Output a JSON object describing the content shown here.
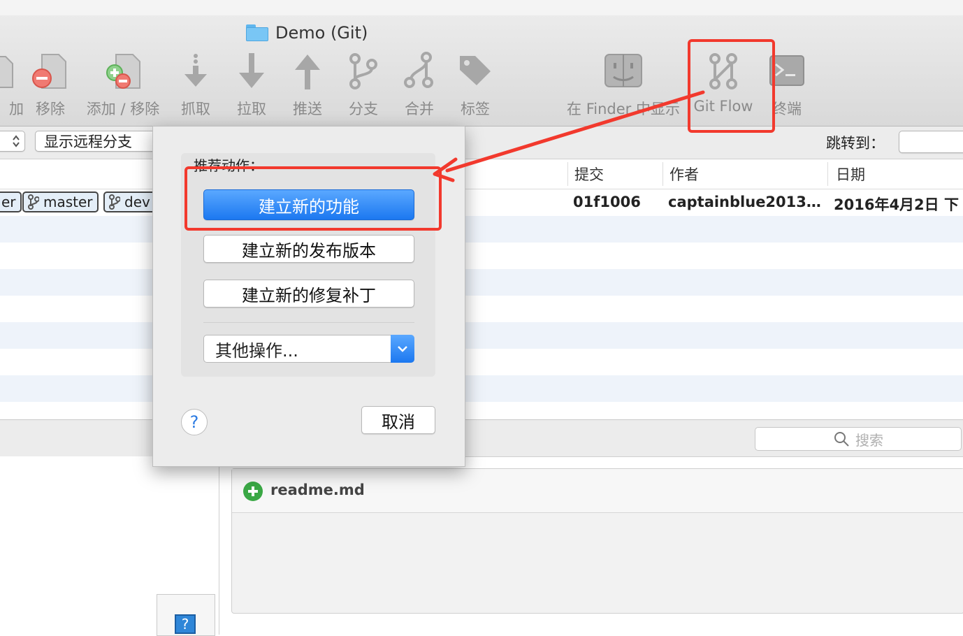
{
  "window": {
    "title": "Demo (Git)"
  },
  "toolbar": {
    "items": [
      {
        "label": "加",
        "icon": "add-file-icon"
      },
      {
        "label": "移除",
        "icon": "remove-file-icon"
      },
      {
        "label": "添加 / 移除",
        "icon": "add-remove-icon"
      },
      {
        "label": "抓取",
        "icon": "fetch-icon"
      },
      {
        "label": "拉取",
        "icon": "pull-icon"
      },
      {
        "label": "推送",
        "icon": "push-icon"
      },
      {
        "label": "分支",
        "icon": "branch-icon"
      },
      {
        "label": "合并",
        "icon": "merge-icon"
      },
      {
        "label": "标签",
        "icon": "tag-icon"
      },
      {
        "label": "在 Finder 中显示",
        "icon": "finder-icon"
      },
      {
        "label": "Git Flow",
        "icon": "git-flow-icon"
      },
      {
        "label": "终端",
        "icon": "terminal-icon"
      }
    ]
  },
  "branch_bar": {
    "remote_toggle": "显示远程分支",
    "jump_label": "跳转到："
  },
  "columns": {
    "commit": "提交",
    "author": "作者",
    "date": "日期"
  },
  "commit_row": {
    "tags": [
      "er",
      "master",
      "dev"
    ],
    "hash": "01f1006",
    "author": "captainblue2013…",
    "date": "2016年4月2日 下"
  },
  "search": {
    "placeholder": "搜索"
  },
  "files": [
    {
      "name": "readme.md",
      "status": "added"
    }
  ],
  "dialog": {
    "section_title": "推荐动作：",
    "primary_button": "建立新的功能",
    "release_button": "建立新的发布版本",
    "hotfix_button": "建立新的修复补丁",
    "other_actions": "其他操作...",
    "help": "?",
    "cancel": "取消"
  },
  "colors": {
    "accent": "#1c78f0",
    "annotation": "#f2392d"
  }
}
